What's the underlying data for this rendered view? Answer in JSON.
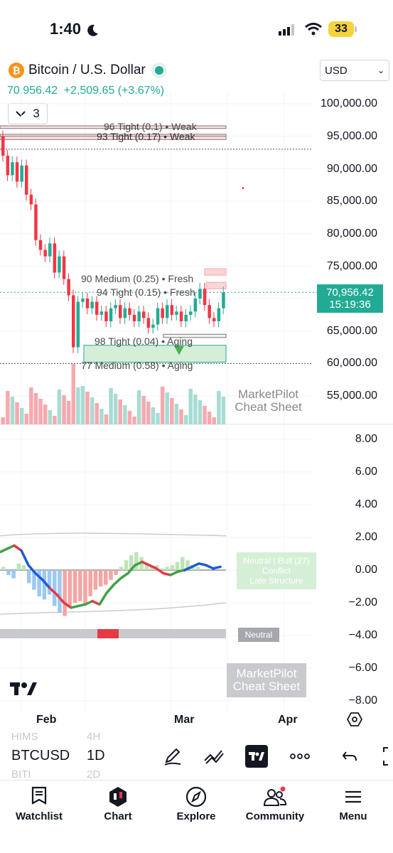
{
  "status_bar": {
    "time": "1:40",
    "battery": "33"
  },
  "header": {
    "title": "Bitcoin / U.S. Dollar",
    "price": "70,956.42",
    "change": "+2,509.65 (+3.67%)",
    "currency": "USD",
    "indicator_count": "3"
  },
  "price_axis": [
    "100,000.00",
    "95,000.00",
    "90,000.00",
    "85,000.00",
    "80,000.00",
    "75,000.00",
    "65,000.00",
    "60,000.00",
    "55,000.00"
  ],
  "price_tag": {
    "price": "70,956.42",
    "countdown": "15:19:36"
  },
  "levels": {
    "l1": "96 Tight (0.1) • Weak",
    "l2": "93 Tight (0.17) • Weak",
    "l3": "90 Medium (0.25) • Fresh",
    "l4": "94 Tight (0.15) • Fresh",
    "l5": "98 Tight (0.04) • Aging",
    "l6": "77 Medium (0.58) • Aging"
  },
  "watermark": {
    "line1": "MarketPilot",
    "line2": "Cheat Sheet"
  },
  "oscillator_axis": [
    "8.00",
    "6.00",
    "4.00",
    "2.00",
    "0.00",
    "−2.00",
    "−4.00",
    "−6.00",
    "−8.00"
  ],
  "oscillator": {
    "status_line1": "Neutral | Bull (27)",
    "status_line2": "Conflict",
    "status_line3": "Late Structure",
    "neutral_tag": "Neutral"
  },
  "time_axis": [
    "Feb",
    "Mar",
    "Apr"
  ],
  "toolbar": {
    "symbol": "BTCUSD",
    "timeframe": "1D",
    "symbol_above": "HIMS",
    "symbol_below": "BITI",
    "timeframe_above": "4H",
    "timeframe_below": "2D"
  },
  "tabs": [
    "Watchlist",
    "Chart",
    "Explore",
    "Community",
    "Menu"
  ],
  "colors": {
    "up": "#22ab94",
    "down": "#f23645",
    "accent": "#22ab94"
  },
  "chart_data": {
    "type": "candlestick",
    "symbol": "BTCUSD",
    "interval": "1D",
    "ylim": [
      52000,
      102000
    ],
    "last_price": 70956.42,
    "candles_close": [
      92000,
      89000,
      91000,
      88000,
      90500,
      86000,
      84500,
      79000,
      77500,
      76500,
      78500,
      74000,
      76500,
      73000,
      70500,
      62500,
      69500,
      70000,
      68500,
      69500,
      67500,
      68000,
      66500,
      68500,
      69000,
      67000,
      68500,
      67500,
      66500,
      68000,
      67000,
      65500,
      66000,
      68500,
      67000,
      69000,
      67500,
      68000,
      66500,
      67500,
      68000,
      70000,
      71500,
      69000,
      67000,
      66500,
      68500,
      70956
    ],
    "oscillator": {
      "ylim": [
        -8,
        8
      ],
      "histogram": [
        0.2,
        -0.3,
        -0.5,
        0.4,
        0.3,
        -0.8,
        -1.2,
        -1.6,
        -1.8,
        -1.5,
        -2.2,
        -2.6,
        -2.8,
        -2.2,
        -2.0,
        -1.9,
        -2.1,
        -1.6,
        -1.2,
        -1.0,
        -0.9,
        -0.6,
        -0.3,
        0.2,
        0.6,
        0.9,
        1.1,
        0.8,
        0.4,
        0.2,
        0.3,
        0.1,
        0.2,
        0.3,
        0.5,
        0.8,
        0.6,
        0.3,
        0.2
      ],
      "signal": [
        1.1,
        1.3,
        1.5,
        1.2,
        0.3,
        -0.2,
        -0.6,
        -1.1,
        -1.5,
        -2.0,
        -2.3,
        -2.2,
        -2.1,
        -1.9,
        -2.1,
        -1.4,
        -0.9,
        -0.5,
        -0.2,
        0.3,
        0.5,
        0.3,
        0.1,
        -0.2,
        -0.3,
        -0.1,
        0.0,
        0.2,
        0.4,
        0.3,
        0.1,
        0.2
      ]
    }
  }
}
